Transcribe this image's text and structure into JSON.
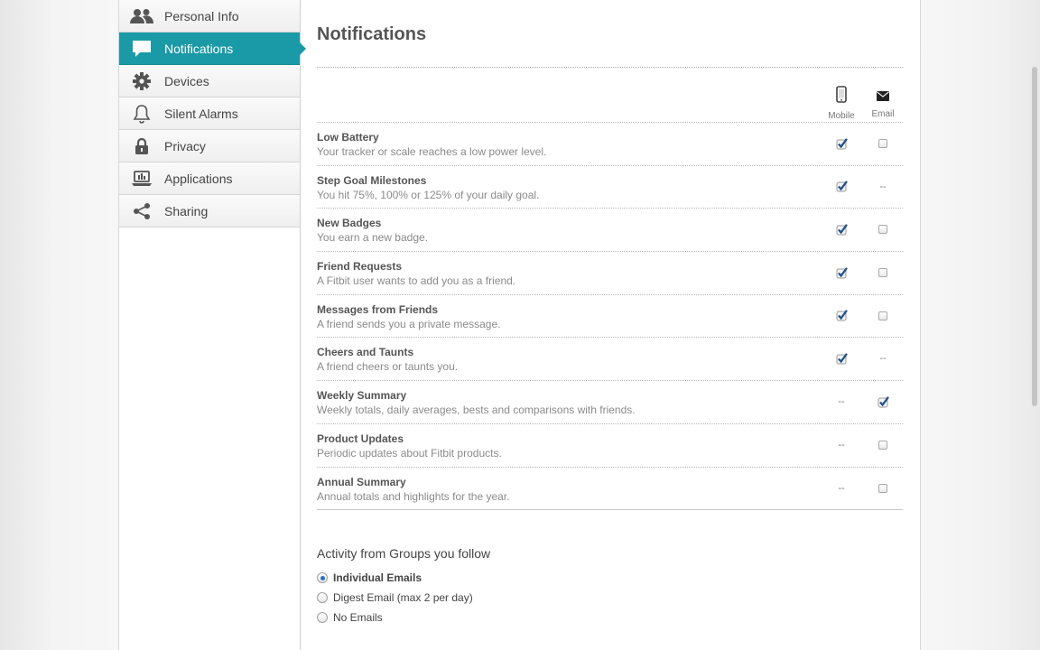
{
  "sidebar": {
    "items": [
      {
        "label": "Personal Info",
        "icon": "people-icon",
        "active": false
      },
      {
        "label": "Notifications",
        "icon": "speech-bubble-icon",
        "active": true
      },
      {
        "label": "Devices",
        "icon": "gear-icon",
        "active": false
      },
      {
        "label": "Silent Alarms",
        "icon": "bell-icon",
        "active": false
      },
      {
        "label": "Privacy",
        "icon": "lock-icon",
        "active": false
      },
      {
        "label": "Applications",
        "icon": "laptop-icon",
        "active": false
      },
      {
        "label": "Sharing",
        "icon": "share-icon",
        "active": false
      }
    ]
  },
  "main": {
    "title": "Notifications",
    "columns": {
      "mobile": {
        "label": "Mobile",
        "icon": "phone-icon"
      },
      "email": {
        "label": "Email",
        "icon": "envelope-icon"
      }
    },
    "rows": [
      {
        "title": "Low Battery",
        "desc": "Your tracker or scale reaches a low power level.",
        "mobile": "checked",
        "email": "unchecked"
      },
      {
        "title": "Step Goal Milestones",
        "desc": "You hit 75%, 100% or 125% of your daily goal.",
        "mobile": "checked",
        "email": "--"
      },
      {
        "title": "New Badges",
        "desc": "You earn a new badge.",
        "mobile": "checked",
        "email": "unchecked"
      },
      {
        "title": "Friend Requests",
        "desc": "A Fitbit user wants to add you as a friend.",
        "mobile": "checked",
        "email": "unchecked"
      },
      {
        "title": "Messages from Friends",
        "desc": "A friend sends you a private message.",
        "mobile": "checked",
        "email": "unchecked"
      },
      {
        "title": "Cheers and Taunts",
        "desc": "A friend cheers or taunts you.",
        "mobile": "checked",
        "email": "--"
      },
      {
        "title": "Weekly Summary",
        "desc": "Weekly totals, daily averages, bests and comparisons with friends.",
        "mobile": "--",
        "email": "checked"
      },
      {
        "title": "Product Updates",
        "desc": "Periodic updates about Fitbit products.",
        "mobile": "--",
        "email": "unchecked"
      },
      {
        "title": "Annual Summary",
        "desc": "Annual totals and highlights for the year.",
        "mobile": "--",
        "email": "unchecked"
      }
    ],
    "groups": {
      "title": "Activity from Groups you follow",
      "options": [
        {
          "label": "Individual Emails",
          "selected": true
        },
        {
          "label": "Digest Email (max 2 per day)",
          "selected": false
        },
        {
          "label": "No Emails",
          "selected": false
        }
      ]
    }
  },
  "colors": {
    "accent": "#1a9aa6",
    "checkmark": "#1f4f8c"
  }
}
